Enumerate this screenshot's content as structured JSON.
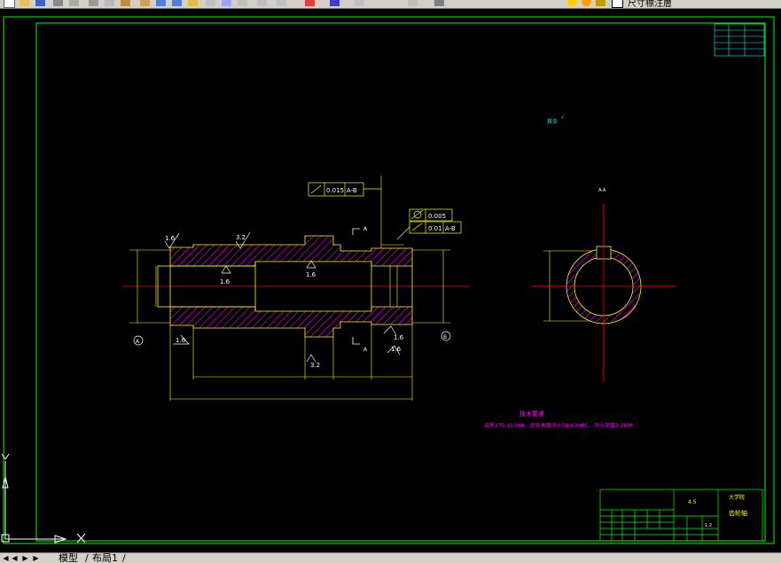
{
  "toolbar": {
    "layer_label": "尺寸標注層",
    "icons": [
      "new-icon",
      "open-icon",
      "save-icon",
      "print-icon",
      "preview-icon",
      "cut-icon",
      "copy-icon",
      "paste-icon",
      "match-icon",
      "undo-icon",
      "redo-icon",
      "pan-icon",
      "zoom-icon",
      "zoom-window-icon",
      "zoom-previous-icon",
      "properties-icon",
      "design-center-icon",
      "tool-palette-icon",
      "calculator-icon",
      "help-icon",
      "layer-manager-icon",
      "layer-state-icon",
      "lightbulb-icon",
      "sun-icon",
      "lock-icon",
      "color-icon"
    ]
  },
  "drawing": {
    "colors": {
      "frame": "#00ff00",
      "geometry": "#ffff00",
      "hatch": "#ff00ff",
      "center": "#ff0000",
      "text_cyan": "#00ffff",
      "text_mag": "#ff00ff",
      "white": "#ffffff"
    },
    "tolerance_frame_1": {
      "value": "0.015",
      "datum": "A-B"
    },
    "tolerance_frame_2": {
      "value": "0.005"
    },
    "tolerance_frame_3": {
      "value": "0.01",
      "datum": "A-B"
    },
    "roughness": {
      "r1": "1.6",
      "r2": "3.2",
      "r3": "1.6",
      "r4": "1.6",
      "r5": "1.6",
      "r6": "3.2",
      "r7": "1.6",
      "r8": "1.6"
    },
    "datum_a": "A",
    "datum_b": "B",
    "section_marker": "A",
    "section_title": "A-A",
    "remark_text": "其余",
    "tech_title": "技术要求",
    "tech_text": "调质275-310HB，齿轮表面淬火58-63HRC，淬火深度2-2MM",
    "scale_value": "4.5",
    "part_name": "齿轮轴",
    "school": "大学院",
    "scale": "1:2"
  },
  "tabs": {
    "model": "模型",
    "layout": "布局1"
  }
}
